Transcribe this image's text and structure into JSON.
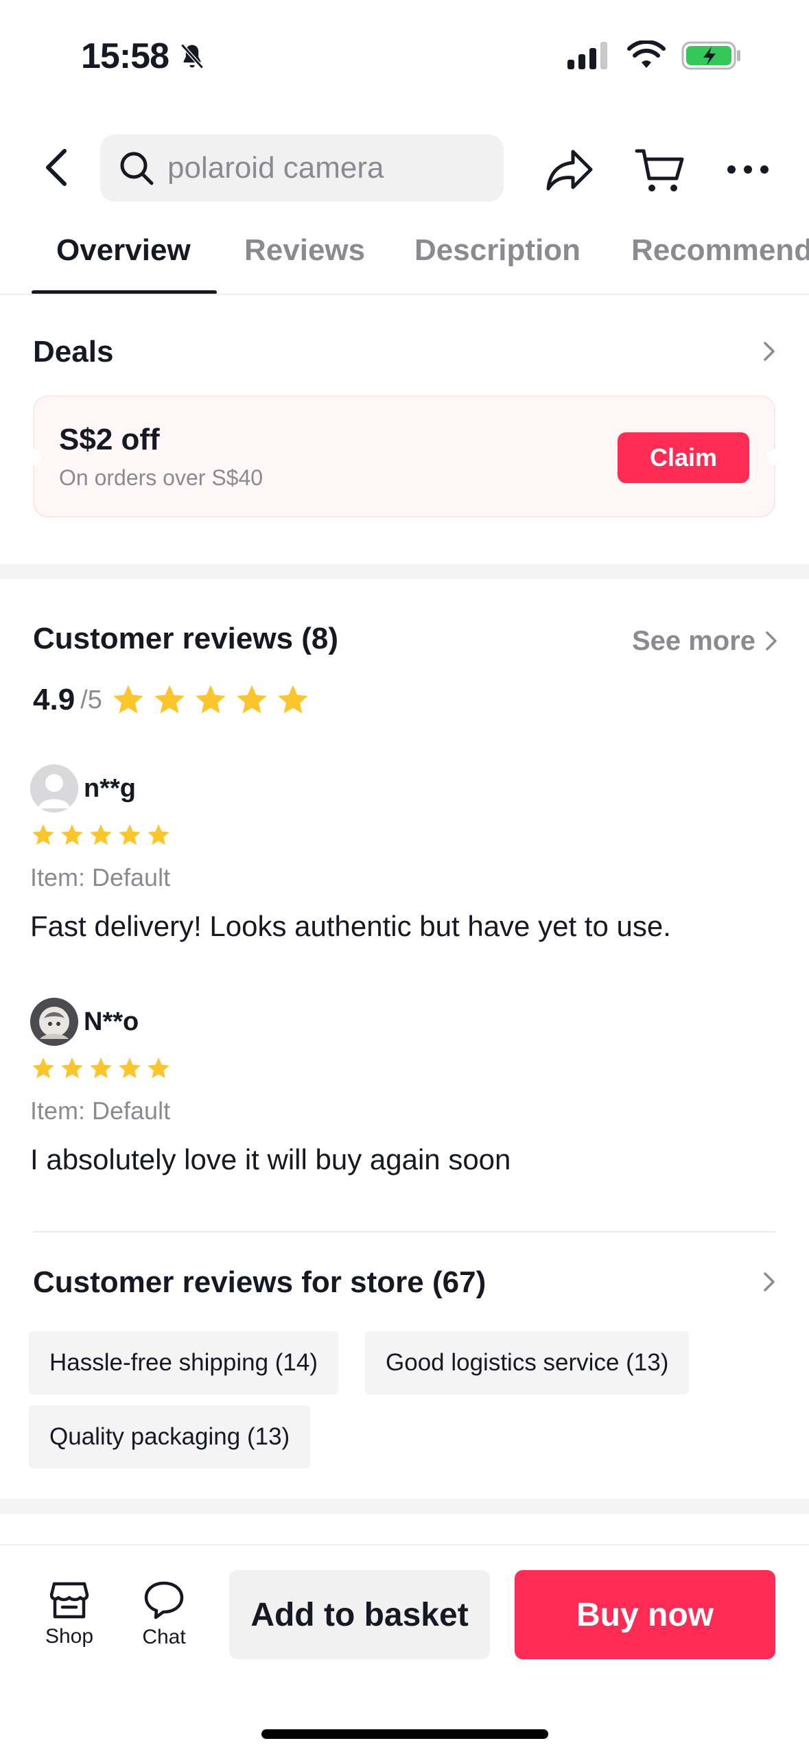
{
  "status_bar": {
    "time": "15:58",
    "icons": [
      "bell-slash-icon",
      "cellular-signal-icon",
      "wifi-icon",
      "battery-charging-icon"
    ]
  },
  "header": {
    "search_value": "polaroid camera",
    "icons": [
      "back-icon",
      "search-icon",
      "share-icon",
      "cart-icon",
      "more-icon"
    ]
  },
  "tabs": [
    {
      "label": "Overview",
      "active": true
    },
    {
      "label": "Reviews",
      "active": false
    },
    {
      "label": "Description",
      "active": false
    },
    {
      "label": "Recommend",
      "active": false
    }
  ],
  "deals": {
    "title": "Deals",
    "coupon_title": "S$2 off",
    "coupon_subtitle": "On orders over S$40",
    "claim_label": "Claim"
  },
  "reviews": {
    "title": "Customer reviews (8)",
    "see_more_label": "See more",
    "rating_value": "4.9",
    "rating_of": "/5",
    "rating_stars": 5,
    "items": [
      {
        "name": "n**g",
        "stars": 5,
        "item_label": "Item: Default",
        "text": "Fast delivery! Looks authentic but have yet to use."
      },
      {
        "name": "N**o",
        "stars": 5,
        "item_label": "Item: Default",
        "text": "I absolutely love it will buy again soon"
      }
    ]
  },
  "store_reviews": {
    "title": "Customer reviews for store (67)",
    "chips": [
      "Hassle-free shipping (14)",
      "Good logistics service (13)",
      "Quality packaging (13)"
    ]
  },
  "bottom_bar": {
    "shop_label": "Shop",
    "chat_label": "Chat",
    "add_to_basket_label": "Add to basket",
    "buy_now_label": "Buy now"
  },
  "colors": {
    "accent": "#fe2c55",
    "star": "#fcc52c",
    "text_primary": "#161823",
    "text_secondary": "#8a8b91"
  }
}
